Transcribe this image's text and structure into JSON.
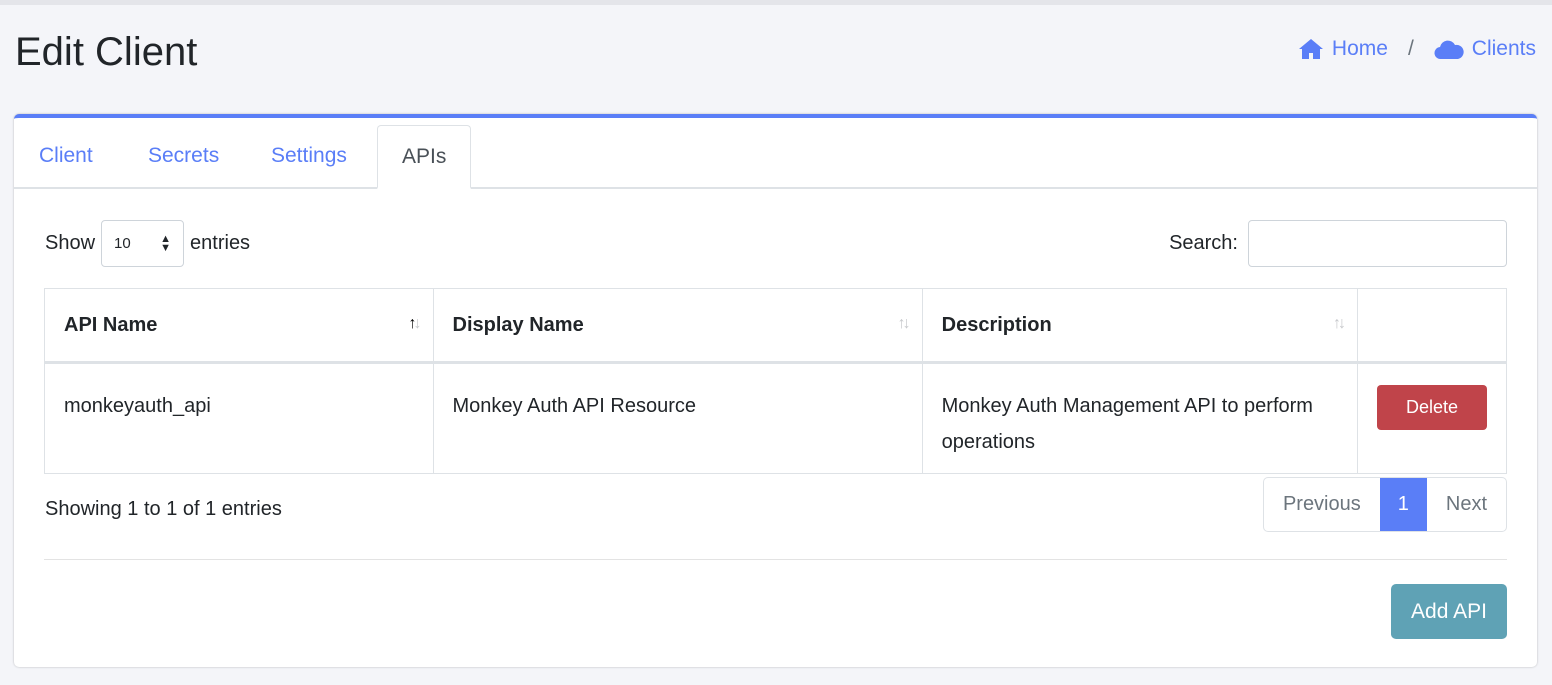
{
  "page": {
    "title": "Edit Client"
  },
  "breadcrumb": {
    "home": "Home",
    "separator": "/",
    "clients": "Clients"
  },
  "tabs": [
    {
      "label": "Client"
    },
    {
      "label": "Secrets"
    },
    {
      "label": "Settings"
    },
    {
      "label": "APIs",
      "active": true
    }
  ],
  "table_controls": {
    "show_label": "Show",
    "page_size": "10",
    "entries_label": "entries",
    "search_label": "Search:",
    "search_value": ""
  },
  "table": {
    "columns": [
      "API Name",
      "Display Name",
      "Description",
      ""
    ],
    "rows": [
      {
        "api_name": "monkeyauth_api",
        "display_name": "Monkey Auth API Resource",
        "description": "Monkey Auth Management API to perform operations",
        "action": "Delete"
      }
    ]
  },
  "footer": {
    "info": "Showing 1 to 1 of 1 entries",
    "previous": "Previous",
    "current_page": "1",
    "next": "Next",
    "add_button": "Add API"
  },
  "colors": {
    "primary": "#5a7ef7",
    "danger": "#c0444a",
    "info": "#5fa2b5"
  }
}
